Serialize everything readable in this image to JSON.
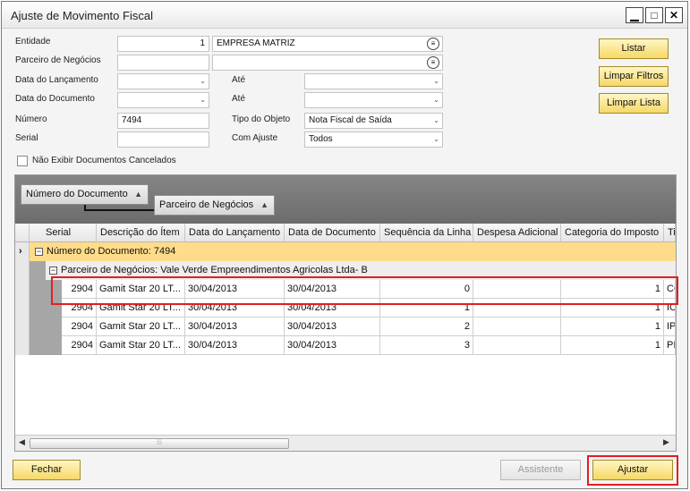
{
  "window": {
    "title": "Ajuste de Movimento Fiscal",
    "minimize_glyph": "▁",
    "maximize_glyph": "□",
    "close_glyph": "✕"
  },
  "form": {
    "entidade_label": "Entidade",
    "entidade_code": "1",
    "entidade_name": "EMPRESA MATRIZ",
    "parceiro_label": "Parceiro de Negócios",
    "parceiro_code": "",
    "parceiro_name": "",
    "data_lancamento_label": "Data do Lançamento",
    "data_lancamento_value": "",
    "ate1_label": "Até",
    "ate1_value": "",
    "data_documento_label": "Data do Documento",
    "data_documento_value": "",
    "ate2_label": "Até",
    "ate2_value": "",
    "numero_label": "Número",
    "numero_value": "7494",
    "tipo_objeto_label": "Tipo do Objeto",
    "tipo_objeto_value": "Nota Fiscal de Saída",
    "serial_label": "Serial",
    "serial_value": "",
    "com_ajuste_label": "Com Ajuste",
    "com_ajuste_value": "Todos",
    "cancelados_label": "Não Exibir Documentos Cancelados",
    "cancelados_checked": false
  },
  "side_buttons": {
    "listar": "Listar",
    "limpar_filtros": "Limpar Filtros",
    "limpar_lista": "Limpar Lista"
  },
  "grid": {
    "group_chips": [
      "Número do Documento",
      "Parceiro de Negócios"
    ],
    "columns": [
      "Serial",
      "Descrição do Ítem",
      "Data do Lançamento",
      "Data de Documento",
      "Sequência da Linha",
      "Despesa Adicional",
      "Categoria do Imposto",
      "Ti"
    ],
    "group1_label": "Número do Documento: 7494",
    "group2_label": "Parceiro de Negócios: Vale Verde Empreendimentos Agricolas Ltda- B",
    "rows": [
      {
        "serial": "2904",
        "descricao": "Gamit Star 20 LT...",
        "data_lanc": "30/04/2013",
        "data_doc": "30/04/2013",
        "seq": "0",
        "despesa": "",
        "categoria": "1",
        "ti": "CO"
      },
      {
        "serial": "2904",
        "descricao": "Gamit Star 20 LT...",
        "data_lanc": "30/04/2013",
        "data_doc": "30/04/2013",
        "seq": "1",
        "despesa": "",
        "categoria": "1",
        "ti": "IC"
      },
      {
        "serial": "2904",
        "descricao": "Gamit Star 20 LT...",
        "data_lanc": "30/04/2013",
        "data_doc": "30/04/2013",
        "seq": "2",
        "despesa": "",
        "categoria": "1",
        "ti": "IP"
      },
      {
        "serial": "2904",
        "descricao": "Gamit Star 20 LT...",
        "data_lanc": "30/04/2013",
        "data_doc": "30/04/2013",
        "seq": "3",
        "despesa": "",
        "categoria": "1",
        "ti": "PI"
      }
    ]
  },
  "footer": {
    "fechar": "Fechar",
    "assistente": "Assistente",
    "ajustar": "Ajustar"
  },
  "colors": {
    "highlight_red": "#e0201e",
    "group_band": "#ffdc8a",
    "button_yellow": "#f6d866"
  }
}
